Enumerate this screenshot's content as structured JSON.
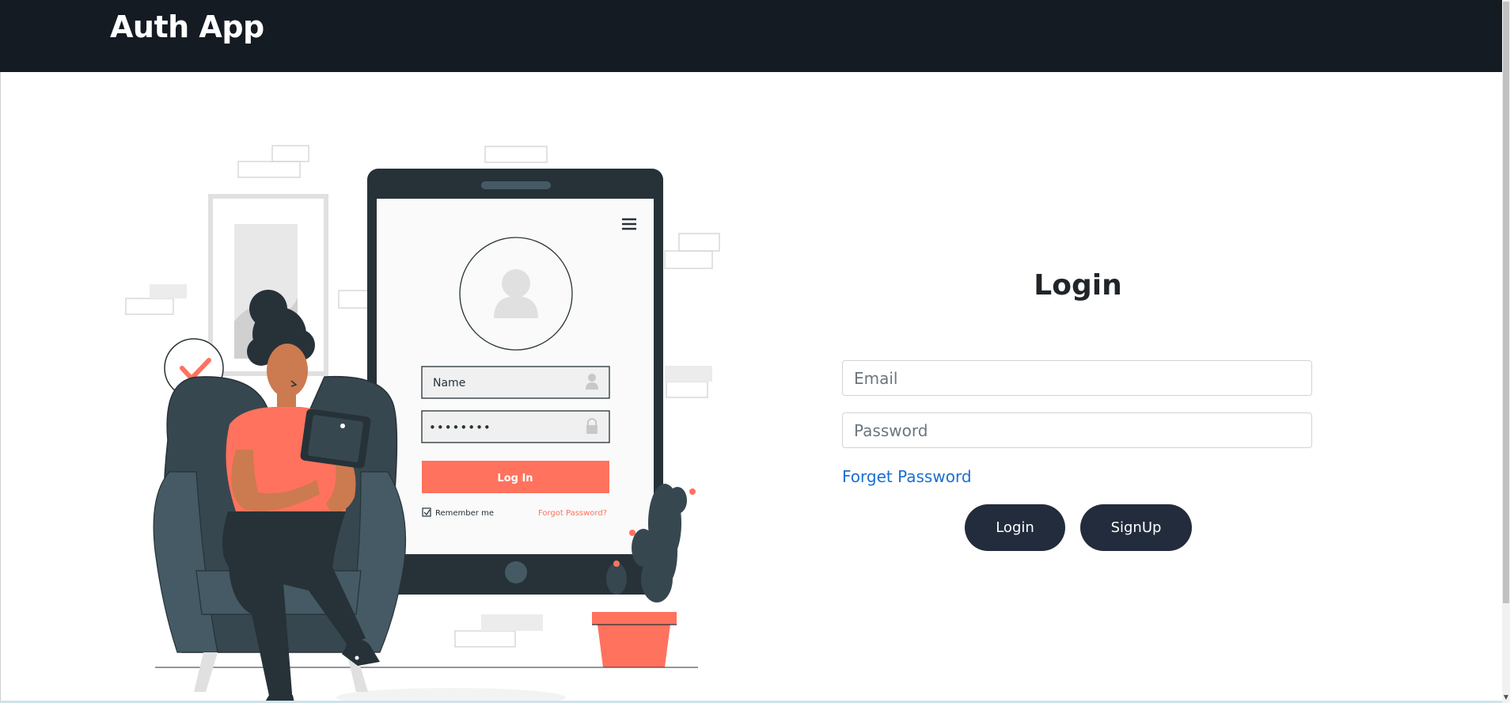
{
  "navbar": {
    "brand": "Auth App"
  },
  "illustration": {
    "screen_name_placeholder": "Name",
    "screen_password_mask": "••••••••",
    "screen_login_button": "Log In",
    "screen_remember_me": "Remember me",
    "screen_forgot_password": "Forgot Password?"
  },
  "login_form": {
    "title": "Login",
    "email_placeholder": "Email",
    "password_placeholder": "Password",
    "forget_password": "Forget Password",
    "login_button": "Login",
    "signup_button": "SignUp"
  },
  "colors": {
    "navbar_bg": "#141b22",
    "button_bg": "#222c3c",
    "link": "#1a6fd3",
    "accent_coral": "#ff725e",
    "device_dark": "#263238"
  }
}
